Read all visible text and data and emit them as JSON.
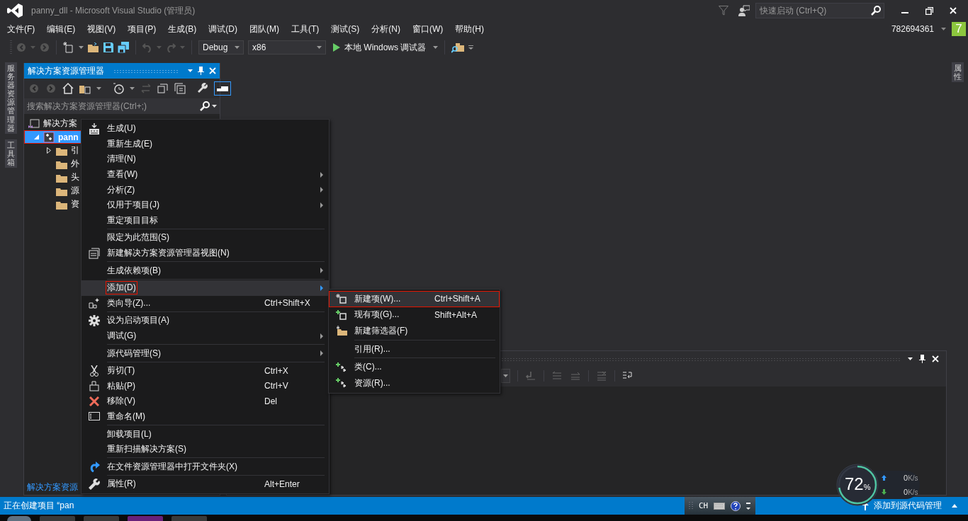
{
  "title_bar": {
    "title": "panny_dll - Microsoft Visual Studio (管理员)",
    "quick_launch": {
      "placeholder": "快速启动 (Ctrl+Q)"
    }
  },
  "menu_bar": {
    "items": [
      "文件(F)",
      "编辑(E)",
      "视图(V)",
      "项目(P)",
      "生成(B)",
      "调试(D)",
      "团队(M)",
      "工具(T)",
      "测试(S)",
      "分析(N)",
      "窗口(W)",
      "帮助(H)"
    ],
    "account": "782694361",
    "notifications": "7"
  },
  "toolbar": {
    "configuration": "Debug",
    "platform": "x86",
    "start": "本地 Windows 调试器"
  },
  "left_strip": {
    "tabs": [
      "服务器资源管理器",
      "工具箱"
    ]
  },
  "solution_explorer": {
    "title": "解决方案资源管理器",
    "search": {
      "placeholder": "搜索解决方案资源管理器(Ctrl+;)"
    },
    "tree": [
      {
        "label": "解决方案",
        "selected": false,
        "outlined": false,
        "children": [
          {
            "label": "pann",
            "selected": true,
            "outlined": true,
            "expanded": true,
            "children": [
              {
                "label": "引",
                "selected": false,
                "outlined": false,
                "expanded": false
              },
              {
                "label": "外",
                "selected": false,
                "outlined": false
              },
              {
                "label": "头",
                "selected": false,
                "outlined": false
              },
              {
                "label": "源",
                "selected": false,
                "outlined": false
              },
              {
                "label": "资",
                "selected": false,
                "outlined": false
              }
            ]
          }
        ]
      }
    ],
    "footer_tab": "解决方案资源"
  },
  "right_strip": {
    "tabs": [
      "属性"
    ]
  },
  "context_menu": {
    "groups": [
      [
        {
          "label": "生成(U)",
          "submenu": false,
          "selected": false,
          "outlined": false
        },
        {
          "label": "重新生成(E)",
          "submenu": false,
          "selected": false,
          "outlined": false
        },
        {
          "label": "清理(N)",
          "submenu": false,
          "selected": false,
          "outlined": false
        },
        {
          "label": "查看(W)",
          "submenu": true,
          "selected": false,
          "outlined": false
        },
        {
          "label": "分析(Z)",
          "submenu": true,
          "selected": false,
          "outlined": false
        },
        {
          "label": "仅用于项目(J)",
          "submenu": true,
          "selected": false,
          "outlined": false
        },
        {
          "label": "重定项目目标",
          "submenu": false,
          "selected": false,
          "outlined": false
        }
      ],
      [
        {
          "label": "限定为此范围(S)",
          "submenu": false,
          "selected": false,
          "outlined": false
        },
        {
          "label": "新建解决方案资源管理器视图(N)",
          "submenu": false,
          "selected": false,
          "outlined": false
        }
      ],
      [
        {
          "label": "生成依赖项(B)",
          "submenu": true,
          "selected": false,
          "outlined": false
        }
      ],
      [
        {
          "label": "添加(D)",
          "submenu": true,
          "selected": true,
          "outlined": true
        },
        {
          "label": "类向导(Z)...",
          "shortcut": "Ctrl+Shift+X",
          "submenu": false,
          "selected": false,
          "outlined": false
        }
      ],
      [
        {
          "label": "设为启动项目(A)",
          "submenu": false,
          "selected": false,
          "outlined": false
        },
        {
          "label": "调试(G)",
          "submenu": true,
          "selected": false,
          "outlined": false
        }
      ],
      [
        {
          "label": "源代码管理(S)",
          "submenu": true,
          "selected": false,
          "outlined": false
        }
      ],
      [
        {
          "label": "剪切(T)",
          "shortcut": "Ctrl+X",
          "submenu": false,
          "selected": false,
          "outlined": false
        },
        {
          "label": "粘贴(P)",
          "shortcut": "Ctrl+V",
          "submenu": false,
          "selected": false,
          "outlined": false
        },
        {
          "label": "移除(V)",
          "shortcut": "Del",
          "submenu": false,
          "selected": false,
          "outlined": false
        },
        {
          "label": "重命名(M)",
          "submenu": false,
          "selected": false,
          "outlined": false
        }
      ],
      [
        {
          "label": "卸载项目(L)",
          "submenu": false,
          "selected": false,
          "outlined": false
        },
        {
          "label": "重新扫描解决方案(S)",
          "submenu": false,
          "selected": false,
          "outlined": false
        }
      ],
      [
        {
          "label": "在文件资源管理器中打开文件夹(X)",
          "submenu": false,
          "selected": false,
          "outlined": false
        }
      ],
      [
        {
          "label": "属性(R)",
          "shortcut": "Alt+Enter",
          "submenu": false,
          "selected": false,
          "outlined": false
        }
      ]
    ]
  },
  "submenu": {
    "groups": [
      [
        {
          "label": "新建项(W)...",
          "shortcut": "Ctrl+Shift+A",
          "selected": true,
          "outlined": true
        },
        {
          "label": "现有项(G)...",
          "shortcut": "Shift+Alt+A",
          "selected": false,
          "outlined": false
        },
        {
          "label": "新建筛选器(F)",
          "selected": false,
          "outlined": false
        }
      ],
      [
        {
          "label": "引用(R)...",
          "selected": false,
          "outlined": false
        }
      ],
      [
        {
          "label": "类(C)...",
          "selected": false,
          "outlined": false
        },
        {
          "label": "资源(R)...",
          "selected": false,
          "outlined": false
        }
      ]
    ]
  },
  "status_bar": {
    "message": "正在创建项目 “pan",
    "ime": "CH",
    "source_control": "添加到源代码管理"
  },
  "network_widget": {
    "percent": "72",
    "unit": "%",
    "upload": {
      "value": "0",
      "unit": "K/s"
    },
    "download": {
      "value": "0",
      "unit": "K/s"
    }
  }
}
